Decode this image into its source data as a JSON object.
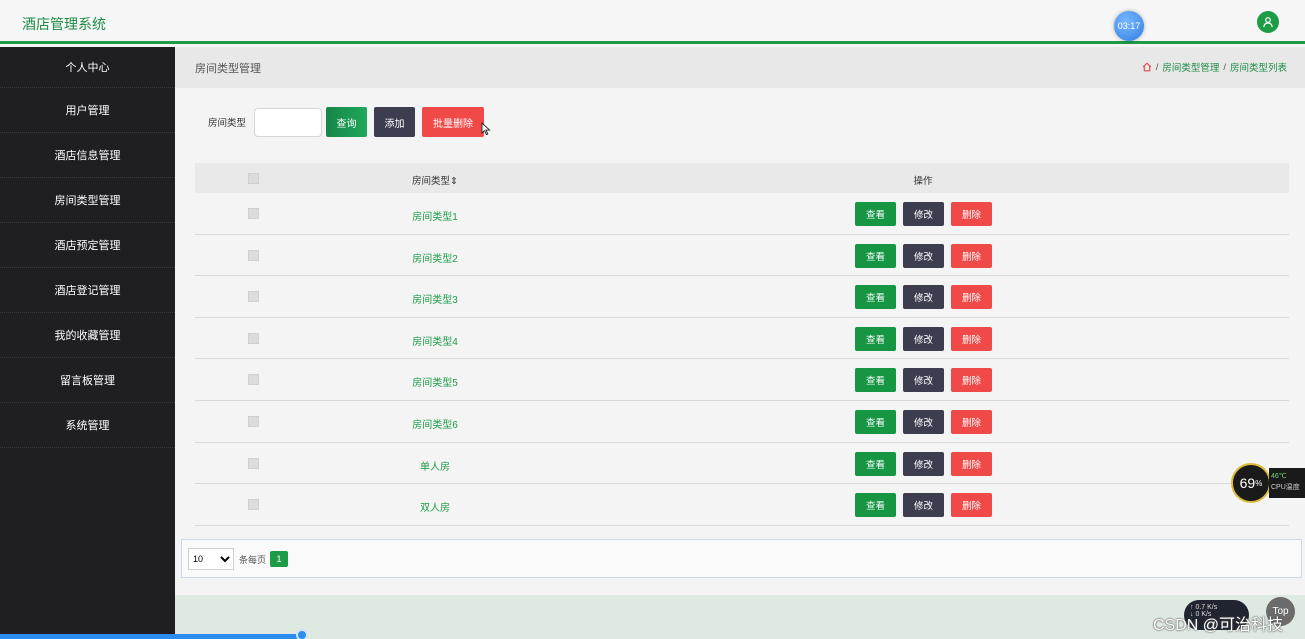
{
  "header": {
    "title": "酒店管理系统",
    "clock": "03:17"
  },
  "sidebar": {
    "items": [
      {
        "label": "个人中心"
      },
      {
        "label": "用户管理"
      },
      {
        "label": "酒店信息管理"
      },
      {
        "label": "房间类型管理"
      },
      {
        "label": "酒店预定管理"
      },
      {
        "label": "酒店登记管理"
      },
      {
        "label": "我的收藏管理"
      },
      {
        "label": "留言板管理"
      },
      {
        "label": "系统管理"
      }
    ]
  },
  "page": {
    "title": "房间类型管理",
    "breadcrumb": [
      "房间类型管理",
      "房间类型列表"
    ],
    "breadcrumb_sep": "/"
  },
  "search": {
    "label": "房间类型",
    "value": "",
    "query_label": "查询",
    "add_label": "添加",
    "batch_delete_label": "批量删除"
  },
  "table": {
    "headers": {
      "type": "房间类型",
      "ops": "操作"
    },
    "sort_indicator": "⇕",
    "rows": [
      {
        "type": "房间类型1"
      },
      {
        "type": "房间类型2"
      },
      {
        "type": "房间类型3"
      },
      {
        "type": "房间类型4"
      },
      {
        "type": "房间类型5"
      },
      {
        "type": "房间类型6"
      },
      {
        "type": "单人房"
      },
      {
        "type": "双人房"
      }
    ],
    "actions": {
      "view": "查看",
      "edit": "修改",
      "delete": "删除"
    }
  },
  "pagination": {
    "page_size": "10",
    "per_page_label": "条每页",
    "current_page": "1"
  },
  "overlays": {
    "cpu_percent": "69",
    "cpu_percent_unit": "%",
    "cpu_temp": "46℃",
    "cpu_label": "CPU温度",
    "net_up": "0.7",
    "net_down": "0",
    "net_unit": "K/s",
    "top_label": "Top",
    "watermark": "CSDN @可治科技"
  },
  "colors": {
    "accent_green": "#1e9b47",
    "sidebar_bg": "#1e1e23",
    "danger_red": "#f04a48",
    "dark_button": "#3c3d4f"
  }
}
